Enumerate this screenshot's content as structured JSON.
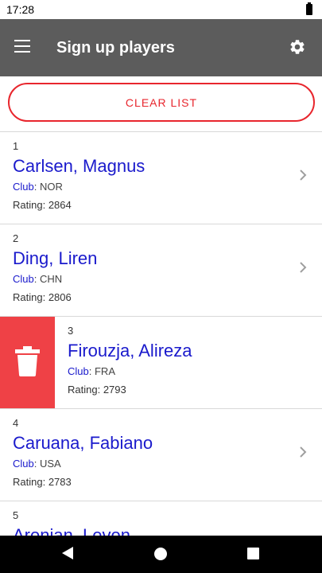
{
  "status_bar": {
    "time": "17:28"
  },
  "app_bar": {
    "title": "Sign up players",
    "menu_icon": "menu-icon",
    "settings_icon": "gear-icon"
  },
  "actions": {
    "clear_label": "CLEAR LIST"
  },
  "colors": {
    "accent": "#e8262d",
    "app_bar": "#5c5c5c",
    "link_blue": "#1a1acc",
    "delete_red": "#ef4146"
  },
  "labels": {
    "club": "Club",
    "rating": "Rating"
  },
  "players": [
    {
      "number": "1",
      "name": "Carlsen, Magnus",
      "club": "NOR",
      "rating": "2864"
    },
    {
      "number": "2",
      "name": "Ding, Liren",
      "club": "CHN",
      "rating": "2806"
    },
    {
      "number": "3",
      "name": "Firouzja, Alireza",
      "club": "FRA",
      "rating": "2793"
    },
    {
      "number": "4",
      "name": "Caruana, Fabiano",
      "club": "USA",
      "rating": "2783"
    },
    {
      "number": "5",
      "name": "Aronian, Levon"
    }
  ]
}
